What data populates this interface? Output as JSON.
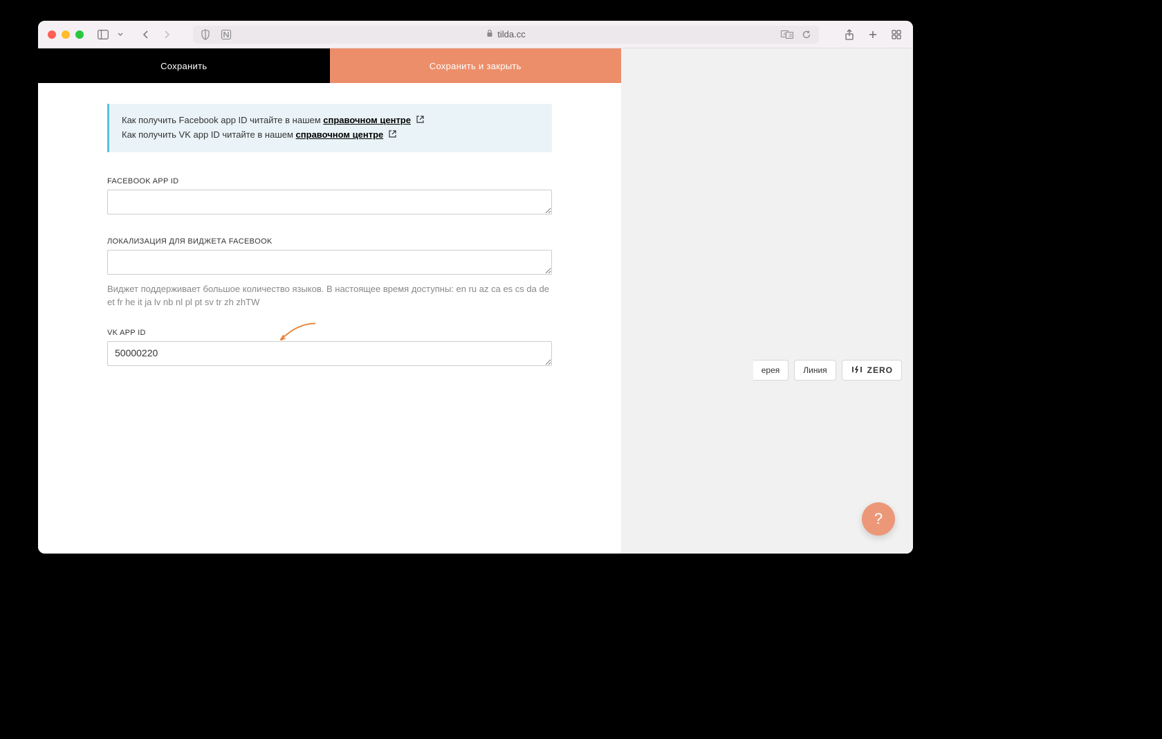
{
  "browser": {
    "url": "tilda.cc"
  },
  "modal": {
    "header": {
      "save": "Сохранить",
      "save_close": "Сохранить и закрыть"
    },
    "info": {
      "fb_prefix": "Как получить Facebook app ID читайте в нашем ",
      "fb_link": "справочном центре",
      "vk_prefix": "Как получить VK app ID читайте в нашем ",
      "vk_link": "справочном центре"
    },
    "fields": {
      "fb_appid_label": "FACEBOOK APP ID",
      "fb_appid_value": "",
      "fb_locale_label": "ЛОКАЛИЗАЦИЯ ДЛЯ ВИДЖЕТА FACEBOOK",
      "fb_locale_value": "",
      "fb_locale_help": "Виджет поддерживает большое количество языков. В настоящее время доступны: en ru az ca es cs da de et fr he it ja lv nb nl pl pt sv tr zh zhTW",
      "vk_appid_label": "VK APP ID",
      "vk_appid_value": "50000220"
    }
  },
  "sidebar_buttons": {
    "gallery": "ерея",
    "line": "Линия",
    "zero": "ZERO"
  },
  "help_fab": "?"
}
